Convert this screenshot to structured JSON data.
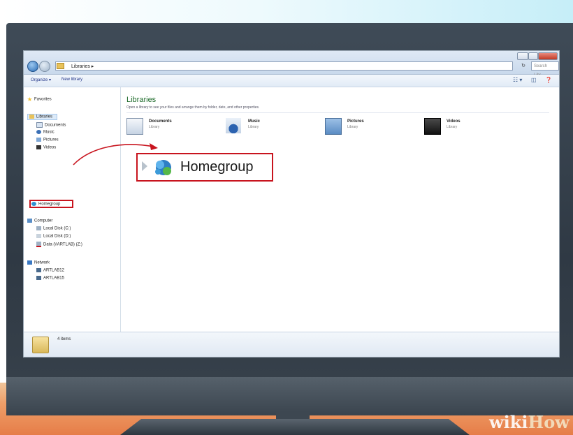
{
  "address": {
    "path": "Libraries",
    "search_placeholder": "Search Libr..."
  },
  "toolbar": {
    "organize": "Organize ▾",
    "new_library": "New library"
  },
  "nav": {
    "favorites": "Favorites",
    "libraries": "Libraries",
    "library_items": [
      "Documents",
      "Music",
      "Pictures",
      "Videos"
    ],
    "homegroup": "Homegroup",
    "computer": "Computer",
    "drives": [
      "Local Disk (C:)",
      "Local Disk (D:)",
      "Data (\\\\ARTLAB) (Z:)"
    ],
    "network": "Network",
    "network_items": [
      "ARTLAB12",
      "ARTLAB15"
    ]
  },
  "content": {
    "title": "Libraries",
    "subtitle": "Open a library to see your files and arrange them by folder, date, and other properties.",
    "libraries": [
      {
        "name": "Documents",
        "type": "Library",
        "icon": "documents-icon"
      },
      {
        "name": "Music",
        "type": "Library",
        "icon": "music-icon"
      },
      {
        "name": "Pictures",
        "type": "Library",
        "icon": "pictures-icon"
      },
      {
        "name": "Videos",
        "type": "Library",
        "icon": "videos-icon"
      }
    ],
    "homegroup_callout": "Homegroup"
  },
  "status": {
    "items": "4 items"
  },
  "watermark": {
    "wiki": "wiki",
    "how": "How"
  },
  "colors": {
    "highlight": "#c8141e",
    "title_green": "#1e6b2b"
  }
}
